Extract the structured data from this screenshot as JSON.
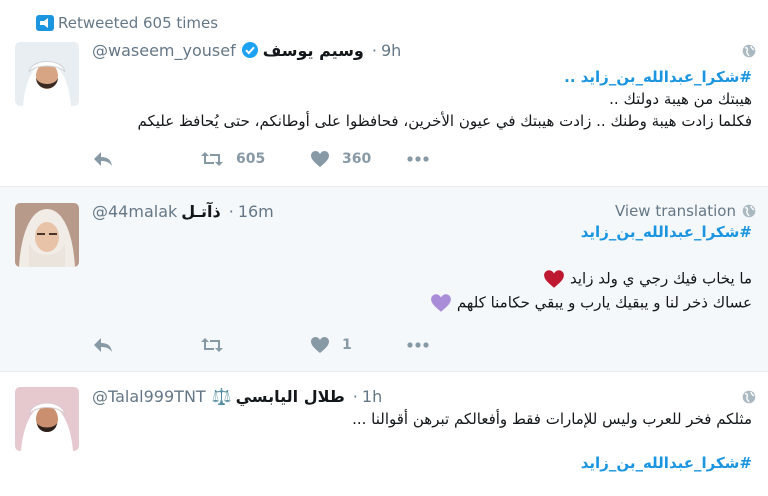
{
  "tweets": [
    {
      "retweet_text": "Retweeted 605 times",
      "handle": "@waseem_yousef",
      "name": "وسيم يوسف",
      "verified": true,
      "time": "9h",
      "lines": [
        "#شكرا_عبدالله_بن_زايد ..",
        "هيبتك من هيبة دولتك ..",
        "فكلما زادت هيبة وطنك .. زادت هيبتك في عيون الأخرين، فحافظوا على أوطانكم، حتى يُحافظ عليكم"
      ],
      "retweets": "605",
      "likes": "360"
    },
    {
      "handle": "@44malak",
      "name": "ذآتـل",
      "time": "16m",
      "view_translation": "View translation",
      "hashtag": "#شكرا_عبدالله_بن_زايد",
      "line1": "ما يخاب فيك رجي ي ولد زايد",
      "line2": "عساك ذخر لنا و يبقيك يارب و يبقي حكامنا كلهم",
      "retweets": "",
      "likes": "1",
      "heart_color_1": "#be1931",
      "heart_color_2": "#aa8dd8"
    },
    {
      "handle": "@Talal999TNT",
      "name": "طلال اليابسي",
      "emoji": "⚖️",
      "time": "1h",
      "line1": "مثلكم فخر للعرب وليس للإمارات فقط وأفعالكم تبرهن أقوالنا ...",
      "hashtag": "#شكرا_عبدالله_بن_زايد"
    }
  ],
  "colors": {
    "link": "#1b95e0",
    "muted": "#657786",
    "icon": "#8899a6",
    "verified": "#1da1f2"
  }
}
